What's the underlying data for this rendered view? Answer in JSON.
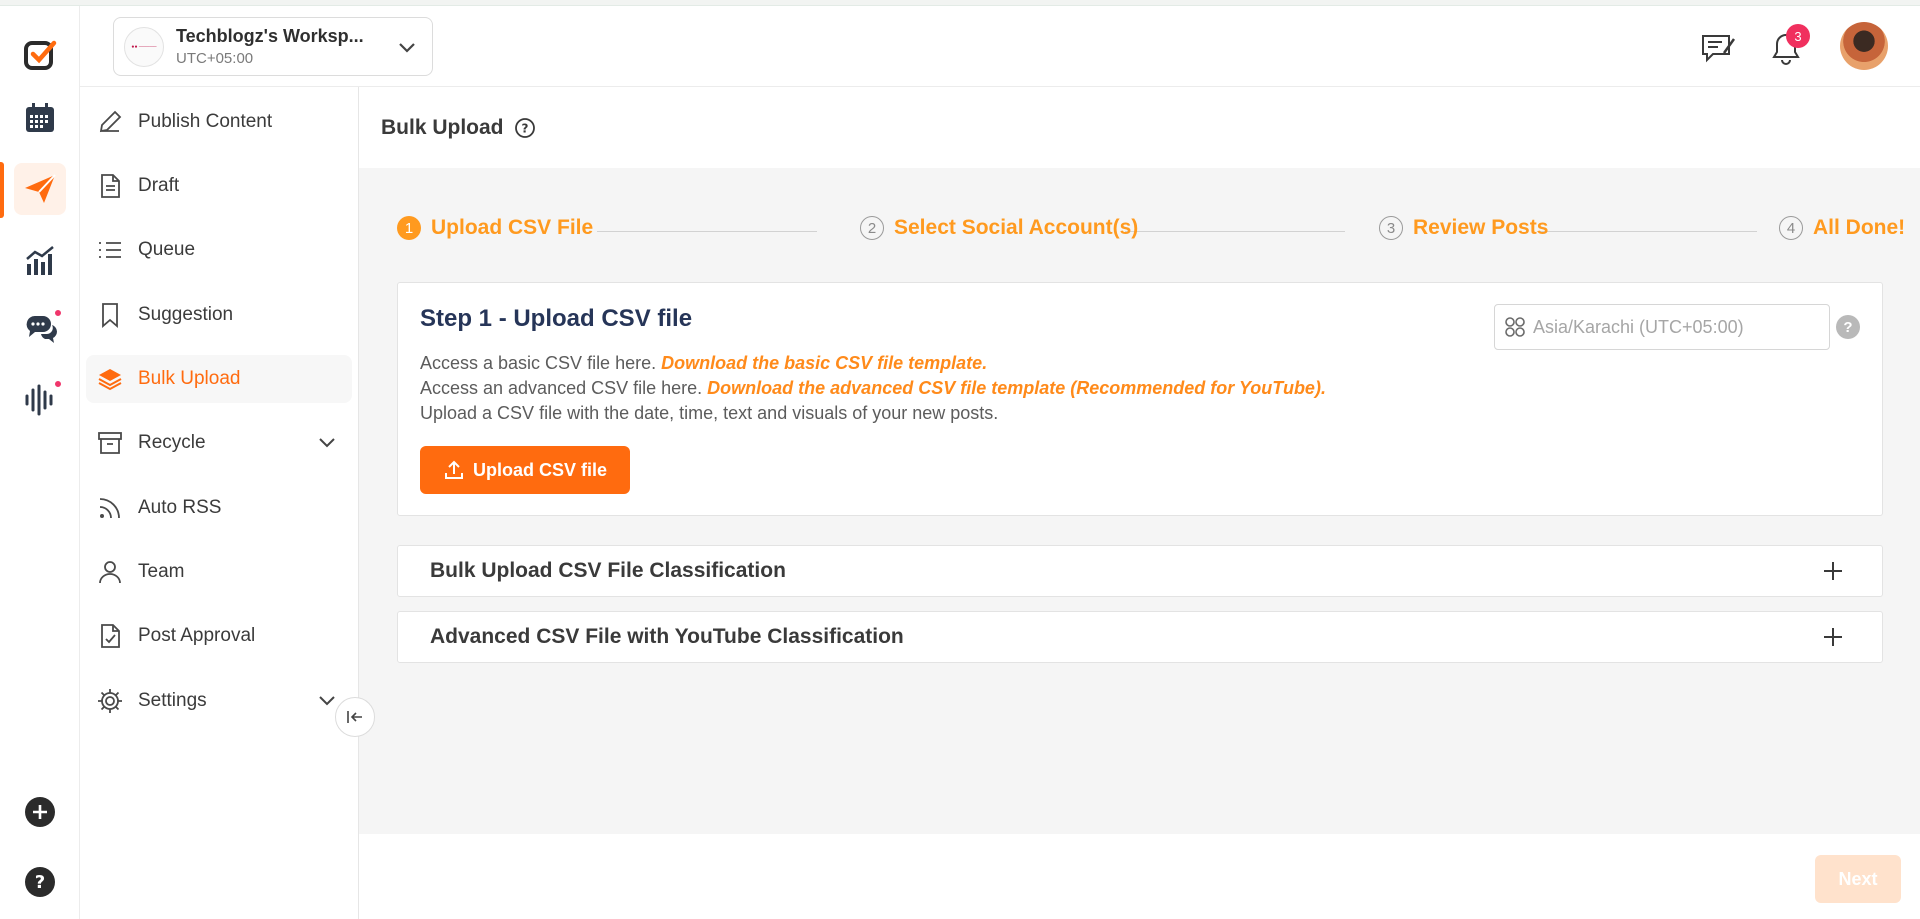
{
  "colors": {
    "accent": "#ff6b0f",
    "step_accent": "#ff9a1f",
    "heading": "#263558",
    "badge": "#f0305e"
  },
  "rail": {
    "items": [
      {
        "name": "logo-icon"
      },
      {
        "name": "calendar-icon"
      },
      {
        "name": "send-icon",
        "active": true
      },
      {
        "name": "analytics-icon"
      },
      {
        "name": "chat-icon"
      },
      {
        "name": "audio-wave-icon"
      },
      {
        "name": "add-icon"
      },
      {
        "name": "help-icon"
      }
    ]
  },
  "header": {
    "workspace_name": "Techblogz's Worksp...",
    "workspace_timezone": "UTC+05:00",
    "notification_count": "3"
  },
  "sidebar": {
    "items": [
      {
        "label": "Publish Content",
        "icon": "pencil-icon"
      },
      {
        "label": "Draft",
        "icon": "document-icon"
      },
      {
        "label": "Queue",
        "icon": "list-icon"
      },
      {
        "label": "Suggestion",
        "icon": "bookmark-icon"
      },
      {
        "label": "Bulk Upload",
        "icon": "layers-icon",
        "active": true
      },
      {
        "label": "Recycle",
        "icon": "archive-icon",
        "expandable": true
      },
      {
        "label": "Auto RSS",
        "icon": "rss-icon"
      },
      {
        "label": "Team",
        "icon": "user-icon"
      },
      {
        "label": "Post Approval",
        "icon": "approval-icon"
      },
      {
        "label": "Settings",
        "icon": "gear-icon",
        "expandable": true
      }
    ]
  },
  "page": {
    "title": "Bulk Upload",
    "steps": [
      {
        "number": "1",
        "label": "Upload CSV File",
        "active": true
      },
      {
        "number": "2",
        "label": "Select Social Account(s)"
      },
      {
        "number": "3",
        "label": "Review Posts"
      },
      {
        "number": "4",
        "label": "All Done!"
      }
    ],
    "card": {
      "title": "Step 1 - Upload CSV file",
      "line1_text": "Access a basic CSV file here.",
      "line1_link": "Download the basic CSV file template.",
      "line2_text": "Access an advanced CSV file here.",
      "line2_link": "Download the advanced CSV file template (Recommended for YouTube).",
      "line3_text": "Upload a CSV file with the date, time, text and visuals of your new posts.",
      "upload_button": "Upload CSV file",
      "timezone_value": "Asia/Karachi (UTC+05:00)",
      "timezone_help": "?"
    },
    "accordions": [
      {
        "label": "Bulk Upload CSV File Classification"
      },
      {
        "label": "Advanced CSV File with YouTube Classification"
      }
    ],
    "next_button": "Next"
  }
}
